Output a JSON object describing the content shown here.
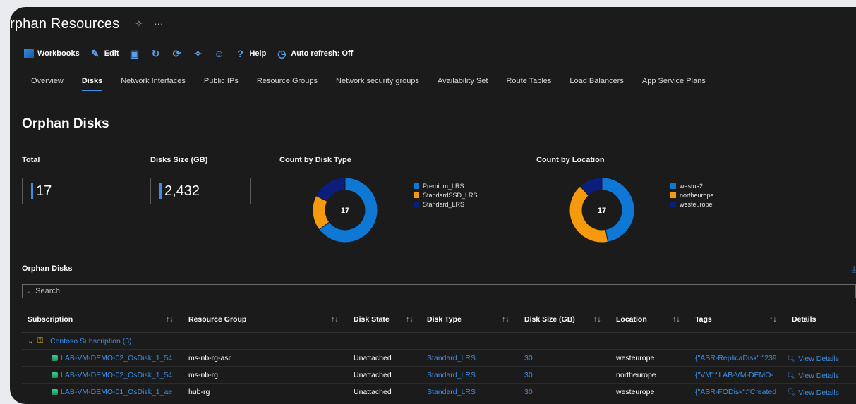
{
  "window": {
    "title": "rphan Resources",
    "pin_glyph": "✧",
    "more_glyph": "···"
  },
  "toolbar": {
    "workbooks": "Workbooks",
    "edit": "Edit",
    "help": "Help",
    "auto_refresh": "Auto refresh: Off"
  },
  "tabs": [
    {
      "label": "Overview"
    },
    {
      "label": "Disks"
    },
    {
      "label": "Network Interfaces"
    },
    {
      "label": "Public IPs"
    },
    {
      "label": "Resource Groups"
    },
    {
      "label": "Network security groups"
    },
    {
      "label": "Availability Set"
    },
    {
      "label": "Route Tables"
    },
    {
      "label": "Load Balancers"
    },
    {
      "label": "App Service Plans"
    }
  ],
  "section": {
    "title": "Orphan Disks"
  },
  "tiles": {
    "total_label": "Total",
    "total_value": "17",
    "size_label": "Disks Size (GB)",
    "size_value": "2,432"
  },
  "charts": {
    "disk_type_title": "Count by Disk Type",
    "location_title": "Count by Location"
  },
  "chart_data": [
    {
      "type": "pie",
      "title": "Count by Disk Type",
      "center_label": "17",
      "categories": [
        "Premium_LRS",
        "StandardSSD_LRS",
        "Standard_LRS"
      ],
      "values": [
        11,
        3,
        3
      ],
      "colors": [
        "#0f78d4",
        "#f59a0e",
        "#0b1f7a"
      ]
    },
    {
      "type": "pie",
      "title": "Count by Location",
      "center_label": "17",
      "categories": [
        "westus2",
        "northeurope",
        "westeurope"
      ],
      "values": [
        8,
        7,
        2
      ],
      "colors": [
        "#0f78d4",
        "#f59a0e",
        "#0b1f7a"
      ]
    }
  ],
  "grid": {
    "title": "Orphan Disks",
    "search_placeholder": "Search",
    "sort_glyph": "↑↓",
    "columns": [
      "Subscription",
      "Resource Group",
      "Disk State",
      "Disk Type",
      "Disk Size (GB)",
      "Location",
      "Tags",
      "Details"
    ],
    "group_label": "Contoso Subscription (3)",
    "rows": [
      {
        "name": "LAB-VM-DEMO-02_OsDisk_1_54",
        "rg": "ms-nb-rg-asr",
        "state": "Unattached",
        "type": "Standard_LRS",
        "size": "30",
        "location": "westeurope",
        "tags": "{\"ASR-ReplicaDisk\":\"239",
        "details": "View Details"
      },
      {
        "name": "LAB-VM-DEMO-02_OsDisk_1_54",
        "rg": "ms-nb-rg",
        "state": "Unattached",
        "type": "Standard_LRS",
        "size": "30",
        "location": "northeurope",
        "tags": "{\"VM\":\"LAB-VM-DEMO-",
        "details": "View Details"
      },
      {
        "name": "LAB-VM-DEMO-01_OsDisk_1_ae",
        "rg": "hub-rg",
        "state": "Unattached",
        "type": "Standard_LRS",
        "size": "30",
        "location": "westeurope",
        "tags": "{\"ASR-FODisk\":\"Created",
        "details": "View Details"
      }
    ]
  }
}
